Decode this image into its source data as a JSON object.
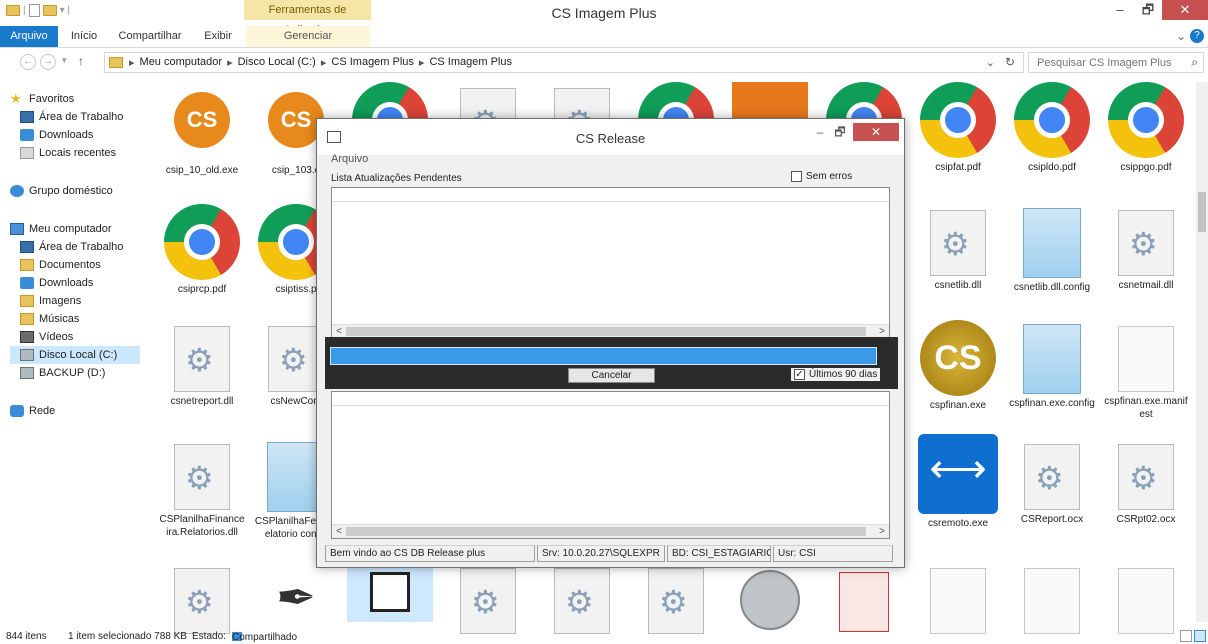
{
  "window": {
    "title": "CS Imagem Plus",
    "context_tab_title": "Ferramentas de Aplicativo",
    "minimize": "–",
    "maximize": "🗗",
    "close": "✕"
  },
  "ribbon": {
    "tabs": [
      "Arquivo",
      "Início",
      "Compartilhar",
      "Exibir",
      "Gerenciar"
    ],
    "expand": "⌄",
    "help": "?"
  },
  "address": {
    "crumbs": [
      "Meu computador",
      "Disco Local (C:)",
      "CS Imagem Plus",
      "CS Imagem Plus"
    ],
    "search_placeholder": "Pesquisar CS Imagem Plus"
  },
  "nav": {
    "items": [
      {
        "label": "Favoritos",
        "icon": "star-icon"
      },
      {
        "label": "Área de Trabalho",
        "icon": "desktop-icon"
      },
      {
        "label": "Downloads",
        "icon": "downloads-icon"
      },
      {
        "label": "Locais recentes",
        "icon": "recent-places-icon"
      },
      {
        "label": "Grupo doméstico",
        "icon": "homegroup-icon"
      },
      {
        "label": "Meu computador",
        "icon": "computer-icon"
      },
      {
        "label": "Área de Trabalho",
        "icon": "desktop-icon"
      },
      {
        "label": "Documentos",
        "icon": "documents-icon"
      },
      {
        "label": "Downloads",
        "icon": "downloads-icon"
      },
      {
        "label": "Imagens",
        "icon": "pictures-icon"
      },
      {
        "label": "Músicas",
        "icon": "music-icon"
      },
      {
        "label": "Vídeos",
        "icon": "videos-icon"
      },
      {
        "label": "Disco Local (C:)",
        "icon": "local-disk-icon"
      },
      {
        "label": "BACKUP (D:)",
        "icon": "drive-icon"
      },
      {
        "label": "Rede",
        "icon": "network-icon"
      }
    ]
  },
  "files": [
    {
      "label": "csip_10_old.exe",
      "icon": "cs-app-icon"
    },
    {
      "label": "csip_103.e",
      "icon": "cs-app-icon"
    },
    {
      "label": "",
      "icon": "chrome-pdf-icon"
    },
    {
      "label": "",
      "icon": "gear-file-icon"
    },
    {
      "label": "",
      "icon": "gear-file-icon"
    },
    {
      "label": "",
      "icon": "chrome-pdf-icon"
    },
    {
      "label": "",
      "icon": "orange-app-icon"
    },
    {
      "label": "",
      "icon": "chrome-pdf-icon"
    },
    {
      "label": "csipfat.pdf",
      "icon": "chrome-pdf-icon"
    },
    {
      "label": "csipldo.pdf",
      "icon": "chrome-pdf-icon"
    },
    {
      "label": "csippgo.pdf",
      "icon": "chrome-pdf-icon"
    },
    {
      "label": "csiprcp.pdf",
      "icon": "chrome-pdf-icon"
    },
    {
      "label": "csiptiss.p",
      "icon": "chrome-pdf-icon"
    },
    {
      "label": "csnetlib.dll",
      "icon": "gear-file-icon"
    },
    {
      "label": "csnetlib.dll.config",
      "icon": "notepad-file-icon"
    },
    {
      "label": "csnetmail.dll",
      "icon": "gear-file-icon"
    },
    {
      "label": "csnetreport.dll",
      "icon": "gear-file-icon"
    },
    {
      "label": "csNewCom",
      "icon": "gear-file-icon"
    },
    {
      "label": "cspfinan.exe",
      "icon": "cs-gold-icon"
    },
    {
      "label": "cspfinan.exe.config",
      "icon": "notepad-file-icon"
    },
    {
      "label": "cspfinan.exe.manifest",
      "icon": "blank-file-icon"
    },
    {
      "label": "CSPlanilhaFinanceira.Relatorios.dll",
      "icon": "gear-file-icon"
    },
    {
      "label": "CSPlanilhaFeira.Relatorio config",
      "icon": "notepad-file-icon"
    },
    {
      "label": "csremoto.exe",
      "icon": "teamviewer-icon"
    },
    {
      "label": "CSReport.ocx",
      "icon": "gear-file-icon"
    },
    {
      "label": "CSRpt02.ocx",
      "icon": "gear-file-icon"
    },
    {
      "label": "",
      "icon": "gear-file-icon"
    },
    {
      "label": "",
      "icon": "pen-file-icon"
    },
    {
      "label": "",
      "icon": "computer-file-icon"
    },
    {
      "label": "",
      "icon": "gear-file-icon"
    },
    {
      "label": "",
      "icon": "gear-file-icon"
    },
    {
      "label": "",
      "icon": "gear-file-icon"
    },
    {
      "label": "",
      "icon": "webcam-file-icon"
    },
    {
      "label": "",
      "icon": "access-file-icon"
    },
    {
      "label": "",
      "icon": "blank-file-icon"
    },
    {
      "label": "",
      "icon": "blank-file-icon"
    },
    {
      "label": "",
      "icon": "blank-file-icon"
    }
  ],
  "statusbar": {
    "count": "844 itens",
    "selection": "1 item selecionado  788 KB",
    "state": "Estado:",
    "state_value": "Compartilhado"
  },
  "dialog": {
    "title": "CS Release",
    "menu": "Arquivo",
    "list_label": "Lista Atualizações Pendentes",
    "sem_erros": "Sem erros",
    "sem_erros_checked": false,
    "ultimos": "Últimos 90 dias",
    "ultimos_checked": true,
    "cancel": "Cancelar",
    "progress": 1.0,
    "status": [
      "Bem vindo ao CS DB Release plus",
      "Srv: 10.0.20.27\\SQLEXPR",
      "BD: CSI_ESTAGIARIO",
      "Usr: CSI"
    ]
  },
  "colors": {
    "accent": "#1979ca",
    "progress": "#3b9ae8",
    "close_red": "#c75050"
  }
}
